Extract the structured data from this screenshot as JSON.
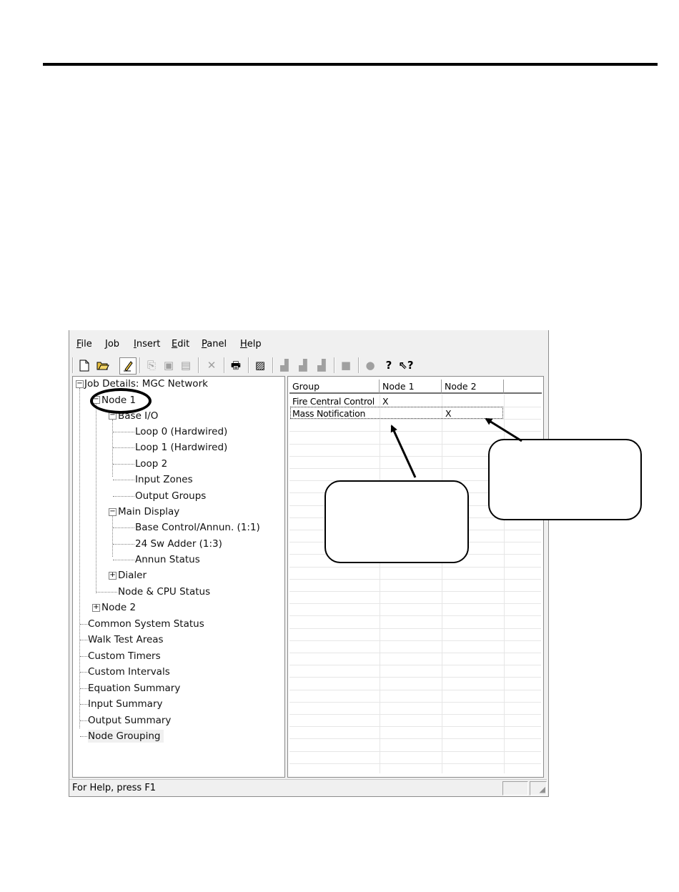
{
  "menu": [
    {
      "label": "File",
      "u": "F",
      "rest": "ile"
    },
    {
      "label": "Job",
      "u": "J",
      "rest": "ob"
    },
    {
      "label": "Insert",
      "u": "I",
      "rest": "nsert"
    },
    {
      "label": "Edit",
      "u": "E",
      "rest": "dit"
    },
    {
      "label": "Panel",
      "u": "P",
      "rest": "anel"
    },
    {
      "label": "Help",
      "u": "H",
      "rest": "elp"
    }
  ],
  "toolbar": {
    "icons": [
      "new-icon",
      "open-icon",
      "edit-icon",
      "copy-icon",
      "paste-icon",
      "paste-special-icon",
      "delete-icon",
      "print-icon",
      "report-icon",
      "upload-icon",
      "download-icon",
      "compare-icon",
      "stop-icon",
      "connect-icon",
      "help-icon",
      "context-help-icon"
    ]
  },
  "tree": {
    "root": "Job Details: MGC Network",
    "node1": "Node 1",
    "base_io": "Base I/O",
    "loop0": "Loop 0  (Hardwired)",
    "loop1": "Loop 1  (Hardwired)",
    "loop2": "Loop 2",
    "input_zones": "Input Zones",
    "output_groups": "Output Groups",
    "main_display": "Main Display",
    "base_control": "Base Control/Annun. (1:1)",
    "sw_adder": "24 Sw Adder (1:3)",
    "annun_status": "Annun Status",
    "dialer": "Dialer",
    "node_cpu": "Node & CPU Status",
    "node2": "Node 2",
    "common_status": "Common System Status",
    "walk_test": "Walk Test Areas",
    "custom_timers": "Custom Timers",
    "custom_intervals": "Custom Intervals",
    "equation_summary": "Equation Summary",
    "input_summary": "Input Summary",
    "output_summary": "Output Summary",
    "node_grouping": "Node Grouping"
  },
  "grid": {
    "columns": [
      "Group",
      "Node 1",
      "Node 2"
    ],
    "rows": [
      {
        "group": "Fire Central Control",
        "node1": "X",
        "node2": ""
      },
      {
        "group": "Mass Notification",
        "node1": "",
        "node2": "X"
      }
    ]
  },
  "status": {
    "text": "For Help, press F1"
  }
}
